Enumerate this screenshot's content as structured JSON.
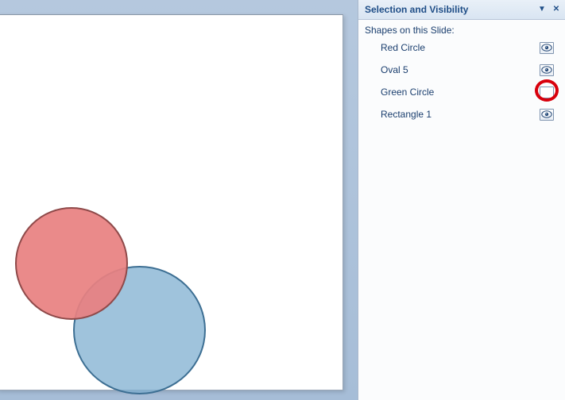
{
  "panel": {
    "title": "Selection and Visibility",
    "section_label": "Shapes on this Slide:",
    "items": [
      {
        "name": "Red Circle",
        "visible": true,
        "highlighted": false
      },
      {
        "name": "Oval 5",
        "visible": true,
        "highlighted": false
      },
      {
        "name": "Green Circle",
        "visible": false,
        "highlighted": true
      },
      {
        "name": "Rectangle 1",
        "visible": true,
        "highlighted": false
      }
    ]
  },
  "shapes_on_canvas": {
    "red_circle": {
      "color": "#e88080",
      "border": "#8f4a4a"
    },
    "oval_5": {
      "color": "#7fafd0",
      "border": "#3d6f93"
    }
  }
}
